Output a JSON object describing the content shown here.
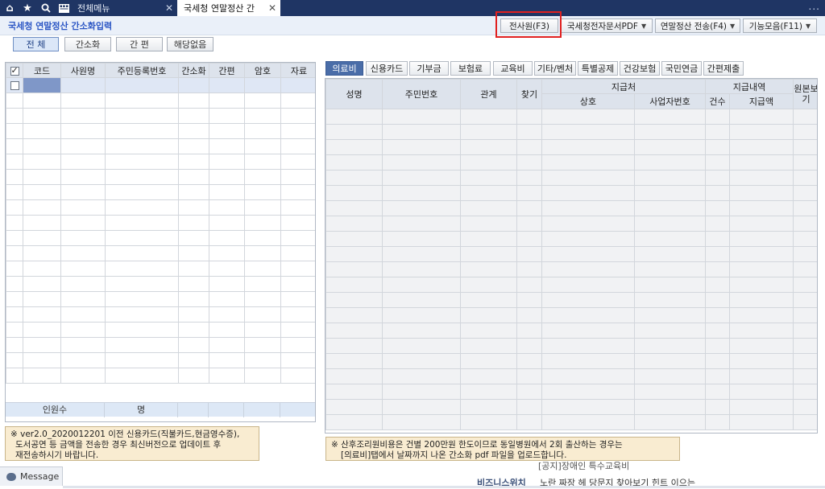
{
  "topbar": {
    "icons": [
      "home-icon",
      "star-icon",
      "search-icon",
      "menu-grid-icon"
    ],
    "tabs": [
      {
        "label": "전체메뉴",
        "close": "✕"
      },
      {
        "label": "국세청 연말정산 간",
        "close": "✕"
      }
    ],
    "more": "..."
  },
  "header": {
    "title": "국세청 연말정산 간소화입력",
    "buttons": [
      {
        "label": "전사원(F3)"
      },
      {
        "label": "국세청전자문서PDF",
        "arrow": "▼"
      },
      {
        "label": "연말정산 전송(F4)",
        "arrow": "▼"
      },
      {
        "label": "기능모음(F11)",
        "arrow": "▼"
      }
    ]
  },
  "filters": [
    {
      "label": "전 체",
      "selected": true
    },
    {
      "label": "간소화"
    },
    {
      "label": "간 편"
    },
    {
      "label": "해당없음"
    }
  ],
  "left_grid": {
    "headers": [
      "코드",
      "사원명",
      "주민등록번호",
      "간소화",
      "간편",
      "암호",
      "자료"
    ],
    "footer": {
      "label": "인원수",
      "unit": "명"
    }
  },
  "right_tabs": [
    "의료비",
    "신용카드",
    "기부금",
    "보험료",
    "교육비",
    "기타/벤처",
    "특별공제",
    "건강보험",
    "국민연금",
    "간편제출"
  ],
  "right_grid": {
    "headers": {
      "name": "성명",
      "rrn": "주민번호",
      "relation": "관계",
      "find": "찾기",
      "payee": "지급처",
      "payee_name": "상호",
      "payee_bizno": "사업자번호",
      "payment": "지급내역",
      "count": "건수",
      "amount": "지급액",
      "original": "원본보기"
    }
  },
  "notes": {
    "left": [
      "※  ver2.0_2020012201 이전 신용카드(직불카드,현금영수증),",
      "도서공연 등 금액을 전송한 경우 최신버전으로 업데이트 후",
      "재전송하시기 바랍니다."
    ],
    "right": [
      "※ 산후조리원비용은 건별 200만원 한도이므로 동일병원에서 2회 출산하는 경우는",
      "[의료비]탭에서 날짜까지 나온 간소화 pdf 파일을 업로드합니다."
    ]
  },
  "background_text": {
    "line1": "[공지]장애인 특수교육비",
    "line2_label": "비즈니스위치",
    "line2_text": "노란 짜장 헤 당문지 찾아보기 힌트 이으는"
  },
  "message_bar": {
    "label": "Message"
  }
}
